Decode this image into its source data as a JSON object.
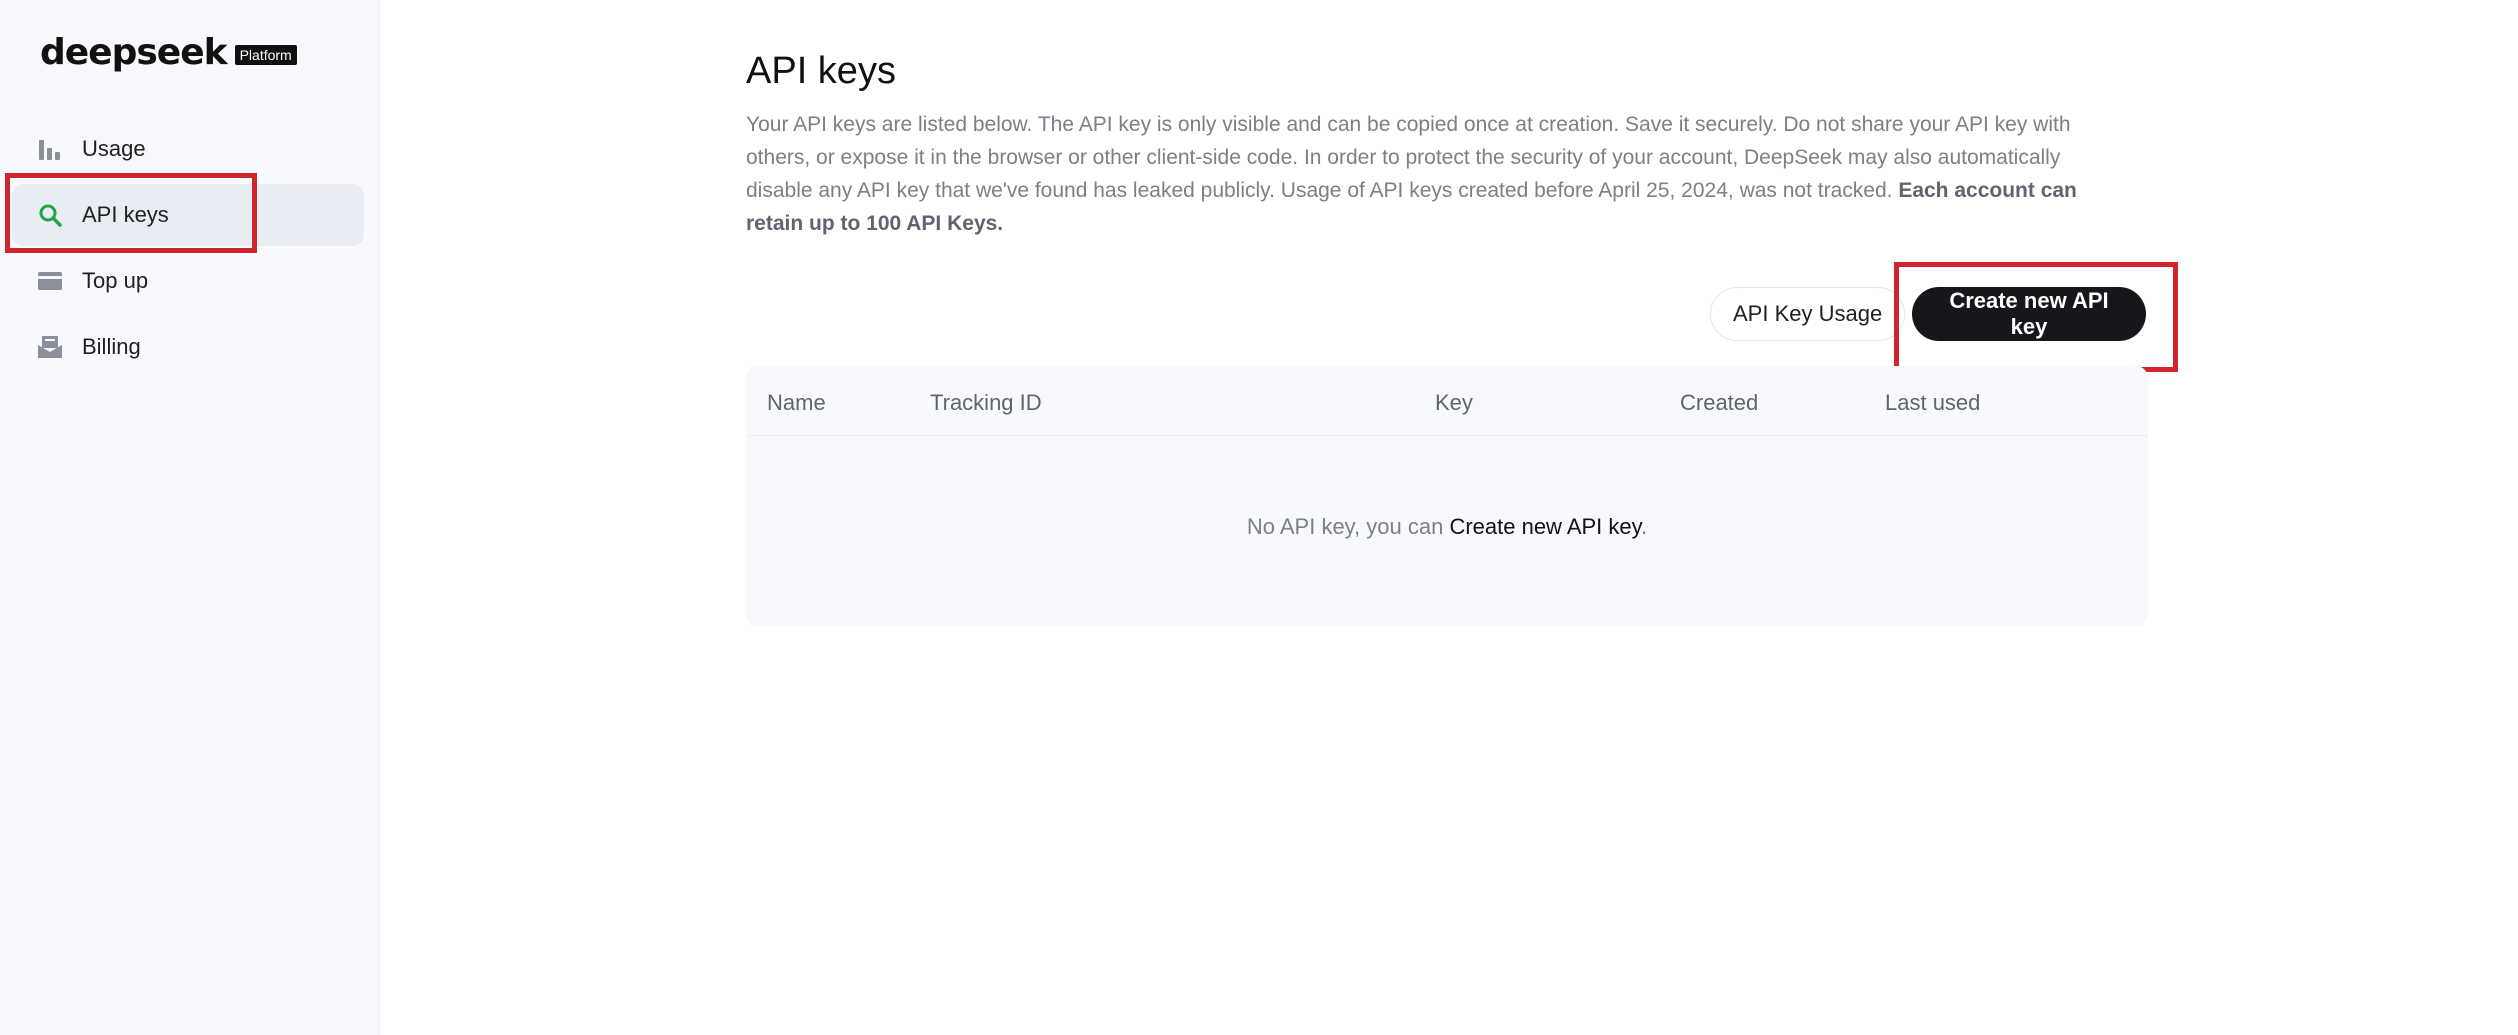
{
  "brand": {
    "logo_text": "deepseek",
    "badge": "Platform"
  },
  "sidebar": {
    "items": [
      {
        "label": "Usage",
        "icon": "bar-chart-icon"
      },
      {
        "label": "API keys",
        "icon": "search-key-icon",
        "active": true
      },
      {
        "label": "Top up",
        "icon": "card-icon"
      },
      {
        "label": "Billing",
        "icon": "billing-icon"
      }
    ]
  },
  "main": {
    "title": "API keys",
    "description": "Your API keys are listed below. The API key is only visible and can be copied once at creation. Save it securely. Do not share your API key with others, or expose it in the browser or other client-side code. In order to protect the security of your account, DeepSeek may also automatically disable any API key that we've found has leaked publicly. Usage of API keys created before April 25, 2024, was not tracked.",
    "description_strong": "Each account can retain up to 100 API Keys.",
    "usage_button": "API Key Usage",
    "create_button": "Create new API key",
    "table": {
      "columns": [
        "Name",
        "Tracking ID",
        "Key",
        "Created",
        "Last used"
      ],
      "empty_prefix": "No API key, you can ",
      "empty_link": "Create new API key",
      "empty_suffix": "."
    }
  },
  "colors": {
    "accent_green": "#22a447",
    "highlight_red": "#d0252c",
    "button_dark": "#15171b"
  }
}
